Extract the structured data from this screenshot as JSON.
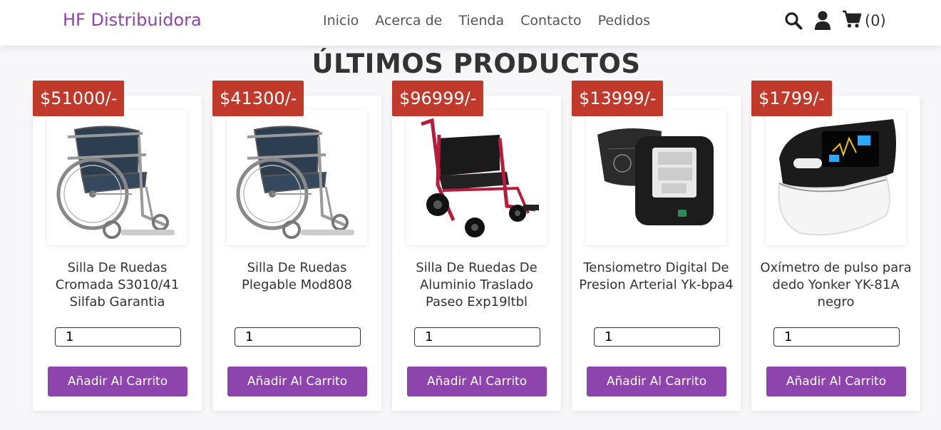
{
  "header": {
    "logo": "HF Distribuidora",
    "nav": [
      "Inicio",
      "Acerca de",
      "Tienda",
      "Contacto",
      "Pedidos"
    ],
    "cart_count": "(0)",
    "icons": {
      "search": "search-icon",
      "user": "user-icon",
      "cart": "cart-icon"
    }
  },
  "section": {
    "title": "ÚLTIMOS PRODUCTOS"
  },
  "products": [
    {
      "price": "$51000/-",
      "name": "Silla De Ruedas Cromada S3010/41 Silfab Garantia",
      "qty": "1",
      "button": "Añadir Al Carrito",
      "image": "wheelchair-chrome"
    },
    {
      "price": "$41300/-",
      "name": "Silla De Ruedas Plegable Mod808",
      "qty": "1",
      "button": "Añadir Al Carrito",
      "image": "wheelchair-chrome"
    },
    {
      "price": "$96999/-",
      "name": "Silla De Ruedas De Aluminio Traslado Paseo Exp19ltbl",
      "qty": "1",
      "button": "Añadir Al Carrito",
      "image": "wheelchair-red"
    },
    {
      "price": "$13999/-",
      "name": "Tensiometro Digital De Presion Arterial Yk-bpa4",
      "qty": "1",
      "button": "Añadir Al Carrito",
      "image": "blood-pressure-monitor"
    },
    {
      "price": "$1799/-",
      "name": "Oxímetro de pulso para dedo Yonker YK-81A negro",
      "qty": "1",
      "button": "Añadir Al Carrito",
      "image": "pulse-oximeter"
    }
  ],
  "colors": {
    "brand": "#8e44ad",
    "price_badge": "#c0392b"
  }
}
